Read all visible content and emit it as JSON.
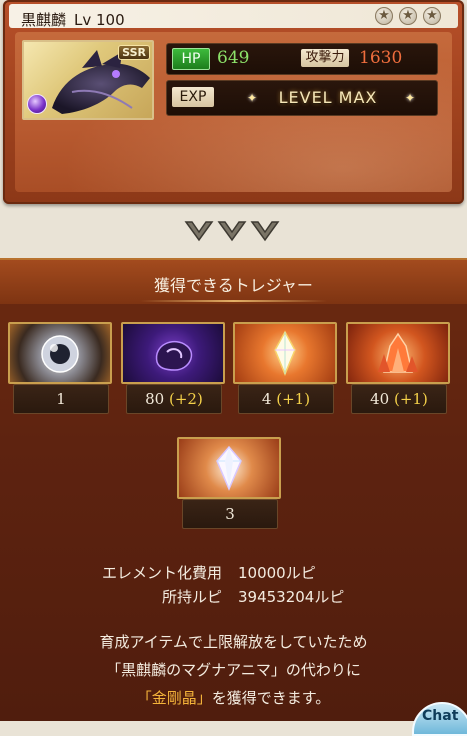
{
  "character": {
    "name": "黒麒麟",
    "level": "Lv 100",
    "rarity": "SSR",
    "stars": [
      "★",
      "★",
      "★"
    ],
    "hp_label": "HP",
    "hp_value": "649",
    "atk_label": "攻撃力",
    "atk_value": "1630",
    "exp_label": "EXP",
    "exp_status": "LEVEL MAX"
  },
  "treasure": {
    "title": "獲得できるトレジャー",
    "items": [
      {
        "icon": "orb-icon",
        "count": "1",
        "bonus": ""
      },
      {
        "icon": "dark-stone-icon",
        "count": "80",
        "bonus": "(+2)"
      },
      {
        "icon": "crystal-icon",
        "count": "4",
        "bonus": "(+1)"
      },
      {
        "icon": "fire-quartz-icon",
        "count": "40",
        "bonus": "(+1)"
      },
      {
        "icon": "diamond-icon",
        "count": "3",
        "bonus": ""
      }
    ]
  },
  "cost": {
    "element_cost_label": "エレメント化費用",
    "element_cost_value": "10000ルピ",
    "owned_rupie_label": "所持ルピ",
    "owned_rupie_value": "39453204ルピ"
  },
  "message": {
    "line1": "育成アイテムで上限解放をしていたため",
    "line2": "「黒麒麟のマグナアニマ」の代わりに",
    "line3_highlight": "「金剛晶」",
    "line3_rest": "を獲得できます。"
  },
  "chat_label": "Chat",
  "colors": {
    "card": "#a3441f",
    "panel": "#5e2310",
    "bonus": "#f4d14a",
    "highlight": "#f4b43a",
    "hp_value": "#8de36a",
    "atk_value": "#ef6d3d"
  }
}
